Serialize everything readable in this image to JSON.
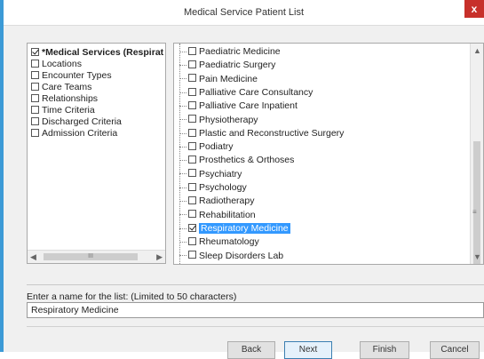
{
  "window": {
    "title": "Medical Service Patient List",
    "close": "x"
  },
  "criteria": [
    {
      "label": "*Medical Services (Respirat",
      "checked": true,
      "bold": true
    },
    {
      "label": "Locations",
      "checked": false
    },
    {
      "label": "Encounter Types",
      "checked": false
    },
    {
      "label": "Care Teams",
      "checked": false
    },
    {
      "label": "Relationships",
      "checked": false
    },
    {
      "label": "Time Criteria",
      "checked": false
    },
    {
      "label": "Discharged Criteria",
      "checked": false
    },
    {
      "label": "Admission Criteria",
      "checked": false
    }
  ],
  "services": [
    {
      "label": "Paediatric Medicine",
      "checked": false
    },
    {
      "label": "Paediatric Surgery",
      "checked": false
    },
    {
      "label": "Pain Medicine",
      "checked": false
    },
    {
      "label": "Palliative Care Consultancy",
      "checked": false
    },
    {
      "label": "Palliative Care Inpatient",
      "checked": false
    },
    {
      "label": "Physiotherapy",
      "checked": false
    },
    {
      "label": "Plastic and Reconstructive Surgery",
      "checked": false
    },
    {
      "label": "Podiatry",
      "checked": false
    },
    {
      "label": "Prosthetics & Orthoses",
      "checked": false
    },
    {
      "label": "Psychiatry",
      "checked": false
    },
    {
      "label": "Psychology",
      "checked": false
    },
    {
      "label": "Radiotherapy",
      "checked": false
    },
    {
      "label": "Rehabilitation",
      "checked": false
    },
    {
      "label": "Respiratory Medicine",
      "checked": true,
      "selected": true
    },
    {
      "label": "Rheumatology",
      "checked": false
    },
    {
      "label": "Sleep Disorders Lab",
      "checked": false
    }
  ],
  "scroll": {
    "hthumb": "III",
    "vgrip": "≡"
  },
  "list_name": {
    "label": "Enter a name for the list: (Limited to 50 characters)",
    "value": "Respiratory Medicine"
  },
  "buttons": {
    "back": "Back",
    "next": "Next",
    "finish": "Finish",
    "cancel": "Cancel"
  },
  "colors": {
    "accent": "#3c9ad6",
    "selection": "#3399ff",
    "close": "#c7302a"
  }
}
